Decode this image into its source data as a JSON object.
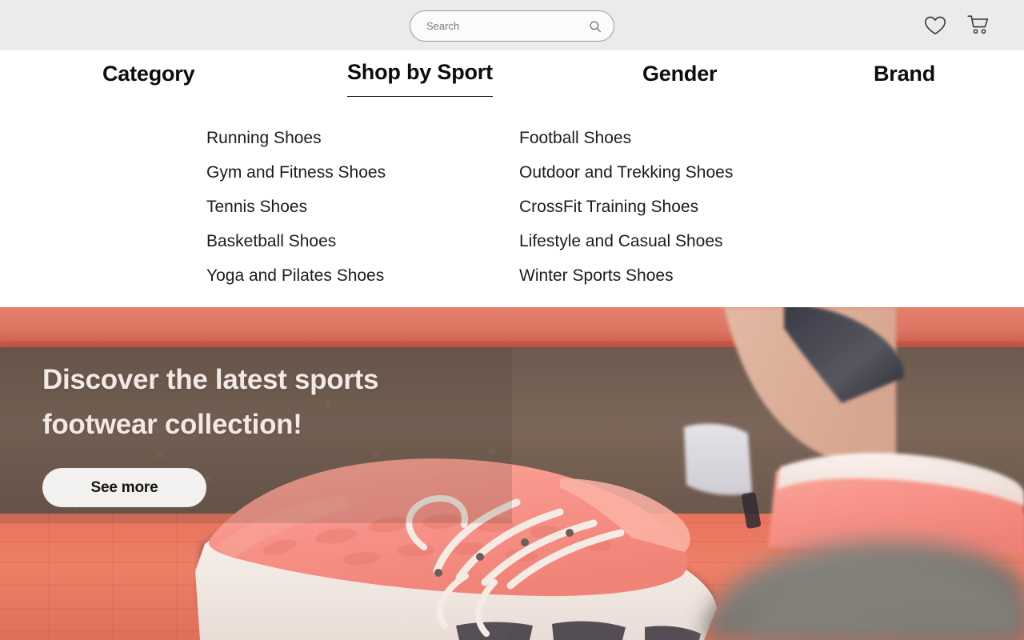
{
  "topbar": {
    "search": {
      "placeholder": "Search",
      "value": "",
      "icon": "search-icon"
    },
    "actions": [
      {
        "name": "wishlist",
        "icon": "heart-icon"
      },
      {
        "name": "cart",
        "icon": "shopping-cart-icon"
      }
    ],
    "background_color": "#ebebeb"
  },
  "nav": {
    "items": [
      {
        "label": "Category",
        "active": false
      },
      {
        "label": "Shop by Sport",
        "active": true
      },
      {
        "label": "Gender",
        "active": false
      },
      {
        "label": "Brand",
        "active": false
      }
    ]
  },
  "megamenu": {
    "columns": [
      {
        "items": [
          "Running Shoes",
          "Gym and Fitness Shoes",
          "Tennis Shoes",
          "Basketball Shoes",
          "Yoga and Pilates Shoes"
        ]
      },
      {
        "items": [
          "Football Shoes",
          "Outdoor and Trekking Shoes",
          "CrossFit Training Shoes",
          "Lifestyle and Casual Shoes",
          "Winter Sports Shoes"
        ]
      }
    ]
  },
  "hero": {
    "title": "Discover the latest sports footwear collection!",
    "button_label": "See more",
    "title_color": "#f1e9e4",
    "button_bg": "#f2f1ef",
    "image_description": "Close-up of pink running shoes on a coral exercise mat",
    "accent_color": "#e3806f"
  }
}
